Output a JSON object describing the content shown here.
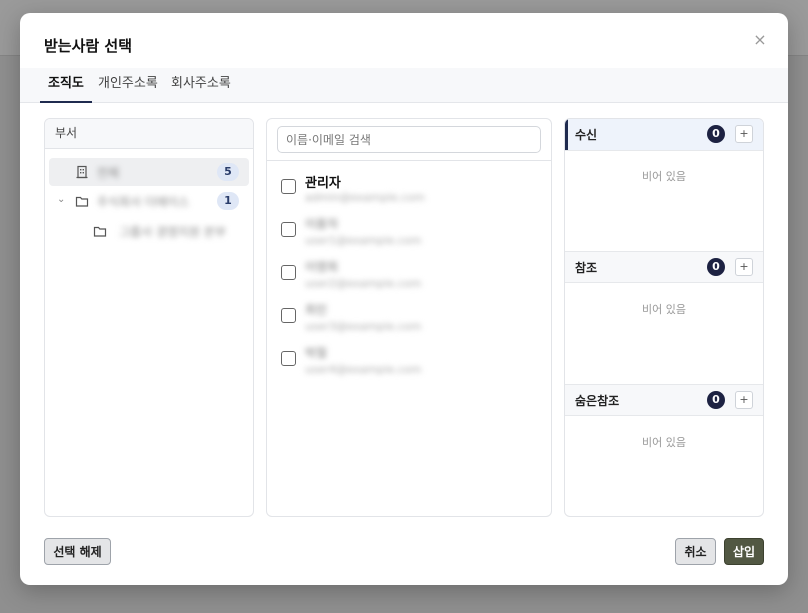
{
  "modal": {
    "title": "받는사람 선택",
    "close_symbol": "×"
  },
  "tabs": [
    {
      "label": "조직도",
      "active": true
    },
    {
      "label": "개인주소록",
      "active": false
    },
    {
      "label": "회사주소록",
      "active": false
    }
  ],
  "departments": {
    "header": "부서",
    "items": [
      {
        "label": "전체",
        "count": "5",
        "icon": "building-icon",
        "selected": true
      },
      {
        "label": "주식회사 더에이스",
        "count": "1",
        "icon": "folder-icon",
        "expanded": true
      },
      {
        "label": "그룹사 경영지원 본부",
        "icon": "folder-icon"
      }
    ]
  },
  "users": {
    "search_placeholder": "이름·이메일 검색",
    "items": [
      {
        "name": "관리자",
        "email": "admin@example.com",
        "name_blurred": false
      },
      {
        "name": "이용자",
        "email": "user1@example.com",
        "name_blurred": true
      },
      {
        "name": "이영희",
        "email": "user2@example.com",
        "name_blurred": true
      },
      {
        "name": "최민",
        "email": "user3@example.com",
        "name_blurred": true
      },
      {
        "name": "박철",
        "email": "user4@example.com",
        "name_blurred": true
      }
    ]
  },
  "recipients": {
    "sections": [
      {
        "label": "수신",
        "count": "0",
        "empty_text": "비어 있음"
      },
      {
        "label": "참조",
        "count": "0",
        "empty_text": "비어 있음"
      },
      {
        "label": "숨은참조",
        "count": "0",
        "empty_text": "비어 있음"
      }
    ],
    "add_symbol": "+"
  },
  "footer": {
    "clear_label": "선택 해제",
    "cancel_label": "취소",
    "insert_label": "삽입"
  },
  "colors": {
    "accent": "#1f2b4f",
    "insert_button": "#525843",
    "badge_bg": "#dfe7f6"
  }
}
